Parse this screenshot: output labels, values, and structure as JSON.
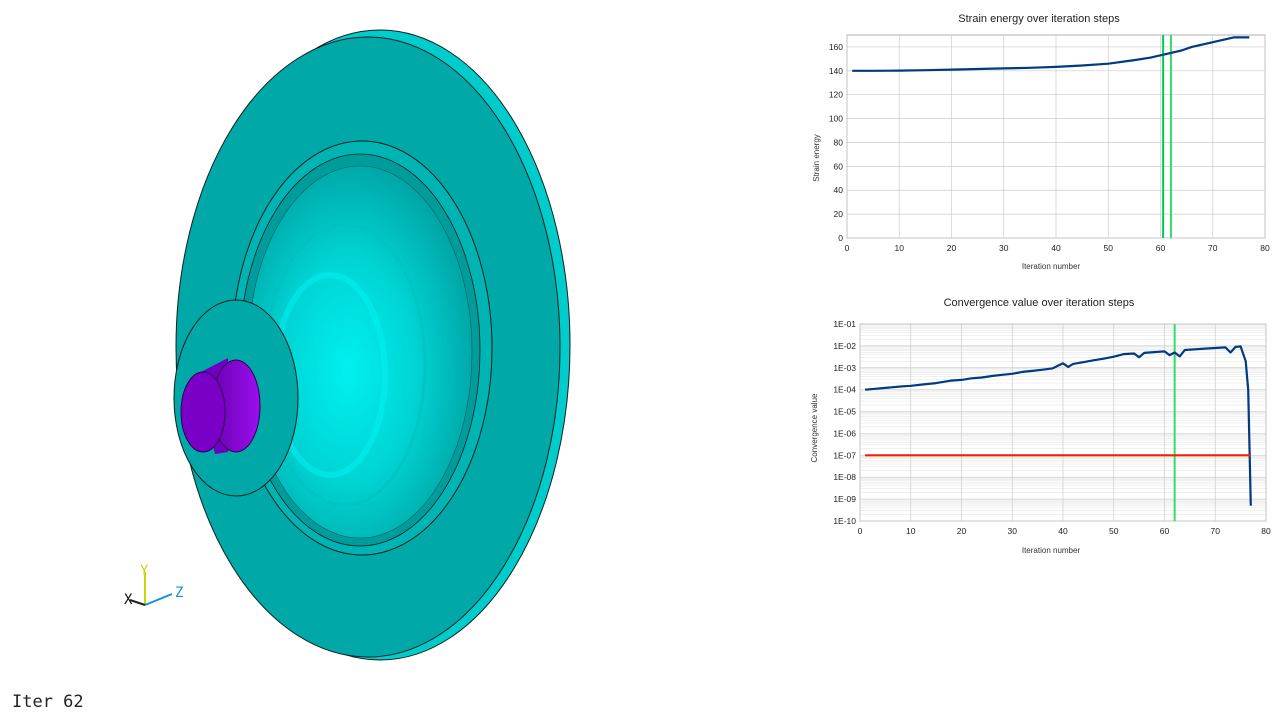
{
  "model_view": {
    "iteration_label": "Iter 62",
    "triad": {
      "x": "X",
      "y": "Y",
      "z": "Z"
    },
    "colors": {
      "part": "#00a8a8",
      "part_light": "#00e0e0",
      "shaft": "#8a00d8",
      "axis_y": "#c8d800",
      "axis_z": "#1a8ce0"
    }
  },
  "chart_data": [
    {
      "type": "line",
      "title": "Strain energy over iteration steps",
      "xlabel": "Iteration number",
      "ylabel": "Strain energy",
      "xlim": [
        0,
        80
      ],
      "ylim": [
        0,
        170
      ],
      "xticks": [
        "0",
        "10",
        "20",
        "30",
        "40",
        "50",
        "60",
        "70",
        "80"
      ],
      "yticks": [
        "0",
        "20",
        "40",
        "60",
        "80",
        "100",
        "120",
        "140",
        "160"
      ],
      "grid": true,
      "series": [
        {
          "color": "#003a80",
          "x": [
            1,
            5,
            10,
            15,
            20,
            25,
            30,
            35,
            40,
            45,
            50,
            55,
            58,
            60,
            62,
            64,
            66,
            68,
            70,
            72,
            74,
            75,
            76,
            77
          ],
          "y": [
            140,
            140,
            140.2,
            140.5,
            141,
            141.5,
            142,
            142.5,
            143.3,
            144.5,
            146,
            149,
            151,
            153,
            155,
            157,
            160,
            162,
            164,
            166,
            168,
            168,
            168,
            168
          ]
        }
      ],
      "marker_lines": [
        {
          "x": 60.5,
          "color": "#00cc55"
        },
        {
          "x": 62,
          "color": "#33dd66"
        }
      ]
    },
    {
      "type": "line",
      "title": "Convergence value over iteration steps",
      "xlabel": "Iteration number",
      "ylabel": "Convergence value",
      "xlim": [
        0,
        80
      ],
      "ylim_log10": [
        -10,
        -1
      ],
      "scale": "log",
      "xticks": [
        "0",
        "10",
        "20",
        "30",
        "40",
        "50",
        "60",
        "70",
        "80"
      ],
      "yticks": [
        "1E-01",
        "1E-02",
        "1E-03",
        "1E-04",
        "1E-05",
        "1E-06",
        "1E-07",
        "1E-08",
        "1E-09",
        "1E-10"
      ],
      "grid": true,
      "series": [
        {
          "color": "#003a80",
          "x": [
            1,
            3,
            5,
            8,
            10,
            13,
            15,
            18,
            20,
            22,
            24,
            26,
            28,
            30,
            32,
            34,
            36,
            38,
            40,
            41,
            42,
            44,
            46,
            48,
            50,
            52,
            54,
            55,
            56,
            58,
            60,
            61,
            62,
            63,
            64,
            66,
            68,
            70,
            72,
            73,
            74,
            75,
            76,
            76.5,
            77
          ],
          "y": [
            0.0001,
            0.00011,
            0.00012,
            0.00014,
            0.00015,
            0.00018,
            0.0002,
            0.00026,
            0.00028,
            0.00033,
            0.00036,
            0.00042,
            0.00048,
            0.00053,
            0.00065,
            0.00072,
            0.00082,
            0.00095,
            0.0016,
            0.0011,
            0.0015,
            0.0018,
            0.0022,
            0.0026,
            0.0032,
            0.0042,
            0.0045,
            0.003,
            0.0048,
            0.0052,
            0.0056,
            0.0038,
            0.005,
            0.0033,
            0.0065,
            0.007,
            0.0075,
            0.008,
            0.0085,
            0.005,
            0.009,
            0.0095,
            0.002,
            0.0001,
            5e-10
          ]
        },
        {
          "color": "#ee2200",
          "x": [
            1,
            77
          ],
          "y": [
            1e-07,
            1e-07
          ]
        }
      ],
      "marker_lines": [
        {
          "x": 62,
          "color": "#33dd66"
        }
      ]
    }
  ]
}
